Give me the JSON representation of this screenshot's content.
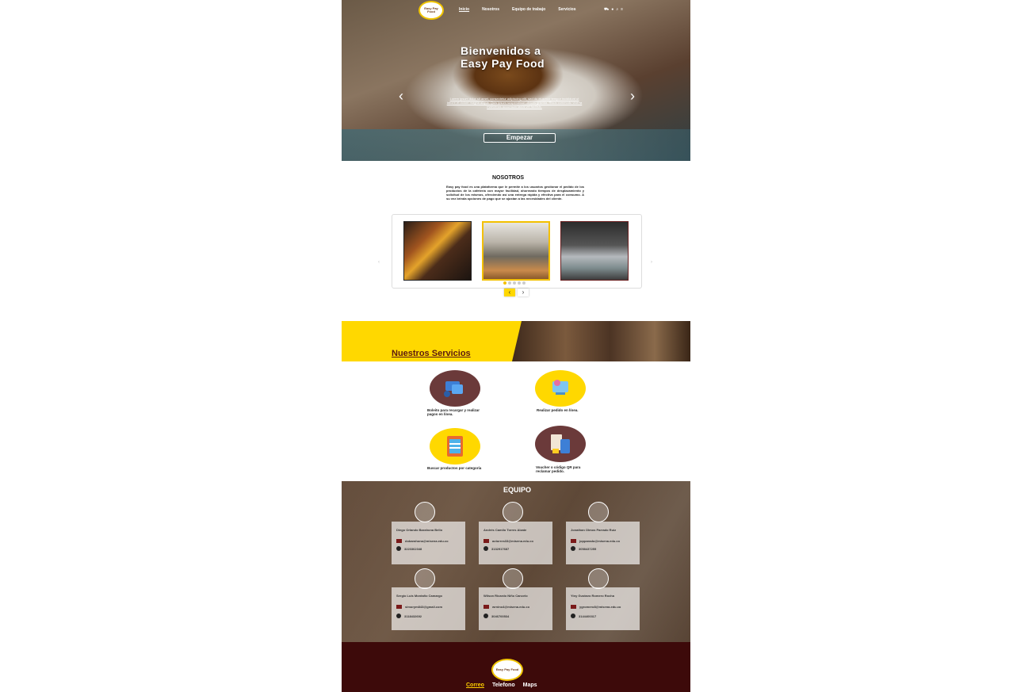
{
  "nav": {
    "logo_text": "Easy Pay Food",
    "items": [
      "Inicio",
      "Nosotros",
      "Equipo de trabajo",
      "Servicios"
    ],
    "icons": [
      "cart-icon",
      "user-icon",
      "search-icon",
      "menu-icon"
    ]
  },
  "hero": {
    "title_line1": "Bienvenidos a",
    "title_line2": "Easy Pay Food",
    "text": "Lorem ipsum dolor sit amet, consectetur adipiscing elit, sed do eiusmod tempor incididunt ut labore et dolore magna aliqua. Quis ipsum suspendisse ultrices gravida. Risus commodo viverra maecenas accumsan lacus vel facilisis.",
    "button": "Empezar",
    "prev": "‹",
    "next": "›"
  },
  "about": {
    "title": "NOSOTROS",
    "text": "Easy pay food es una plataforma que le permite a los usuarios gestionar el pedido de los productos de la cafetería con mayor facilidad, ahorrando tiempos de desplazamiento y solicitud de los mismos, ofreciendo así una entrega rápida y efectiva para el consumo. A su vez brinda opciones de pago que se ajustan a las necesidades del cliente.",
    "carousel_prev": "‹",
    "carousel_next": "›",
    "side_prev": "‹",
    "side_next": "›"
  },
  "services": {
    "title": "Nuestros Servicios",
    "items": [
      {
        "label": "Boleito para recargar y realizar pagos en línea.",
        "icon": "wallet-icon"
      },
      {
        "label": "Realizar pedido en línea.",
        "icon": "online-order-icon"
      },
      {
        "label": "Buscar productos por categoría",
        "icon": "catalog-icon"
      },
      {
        "label": "Voucher o código QR para reclamar pedido.",
        "icon": "qr-voucher-icon"
      }
    ]
  },
  "team": {
    "title": "EQUIPO",
    "members": [
      {
        "name": "Diego Orlando Barahona Bello",
        "email": "dobarahona@misena.edu.co",
        "phone": "3223362348"
      },
      {
        "name": "Andrés Camilo Torres Alzate",
        "email": "actorres33@misena.edu.co",
        "phone": "3132917687"
      },
      {
        "name": "Jonathan Olmos Parrado Ruiz",
        "email": "jopparado@misena.edu.co",
        "phone": "3058437255"
      },
      {
        "name": "Sergio Luis Montaño Camargo",
        "email": "slmorym843@gmail.com",
        "phone": "3118432692"
      },
      {
        "name": "Wilson Ricardo Niño Cancelo",
        "email": "wrnino4@misena.edu.co",
        "phone": "3046700534"
      },
      {
        "name": "Yiny Gustavo Romero Rocha",
        "email": "ygromero8@misena.edu.co",
        "phone": "3144400317"
      }
    ]
  },
  "footer": {
    "logo_text": "Easy Pay Food",
    "links": [
      "Correo",
      "Telefono",
      "Maps"
    ]
  },
  "colors": {
    "accent_yellow": "#ffd800",
    "brand_maroon": "#3d0a0a",
    "service_brown": "#6b3a3a"
  }
}
